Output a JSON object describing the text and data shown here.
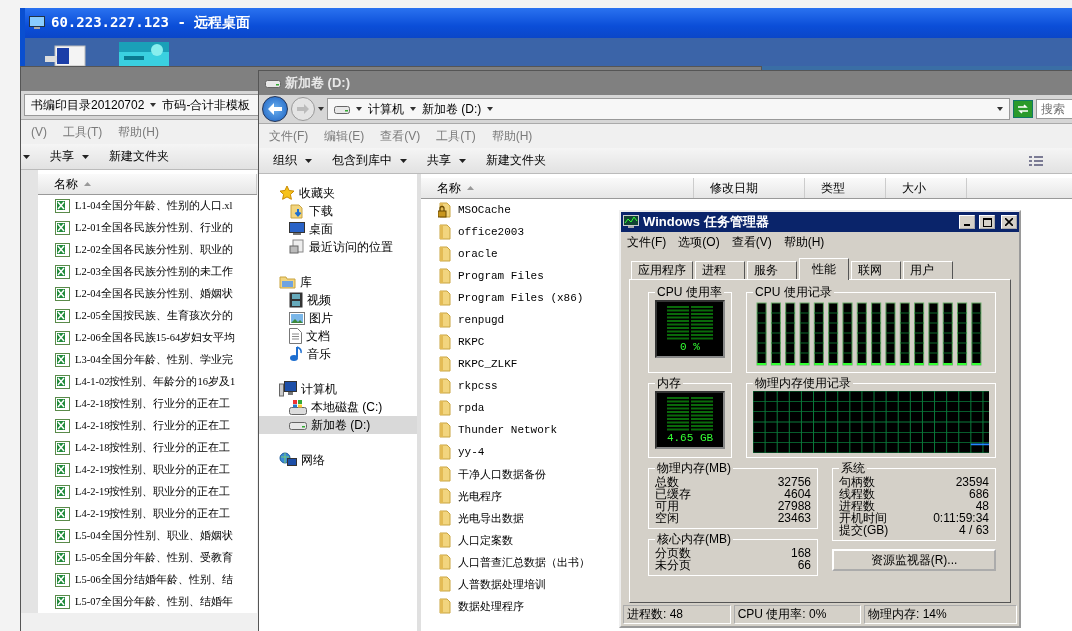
{
  "remote_window": {
    "title": "60.223.227.123 - 远程桌面"
  },
  "explorer_back": {
    "breadcrumb": [
      "书编印目录20120702",
      "市码-合计非模板"
    ],
    "menu": [
      "(V)",
      "工具(T)",
      "帮助(H)"
    ],
    "toolbar": [
      {
        "label": "共享",
        "dropdown": true
      },
      {
        "label": "新建文件夹",
        "dropdown": false
      }
    ],
    "columns": [
      "名称"
    ],
    "files": [
      "L1-04全国分年龄、性别的人口.xl",
      "L2-01全国各民族分性别、行业的",
      "L2-02全国各民族分性别、职业的",
      "L2-03全国各民族分性别的未工作",
      "L2-04全国各民族分性别、婚姻状",
      "L2-05全国按民族、生育孩次分的",
      "L2-06全国各民族15-64岁妇女平均",
      "L3-04全国分年龄、性别、学业完",
      "L4-1-02按性别、年龄分的16岁及1",
      "L4-2-18按性别、行业分的正在工",
      "L4-2-18按性别、行业分的正在工",
      "L4-2-18按性别、行业分的正在工",
      "L4-2-19按性别、职业分的正在工",
      "L4-2-19按性别、职业分的正在工",
      "L4-2-19按性别、职业分的正在工",
      "L5-04全国分性别、职业、婚姻状",
      "L5-05全国分年龄、性别、受教育",
      "L5-06全国分结婚年龄、性别、结",
      "L5-07全国分年龄、性别、结婚年"
    ]
  },
  "explorer_front": {
    "title": "新加卷 (D:)",
    "path": [
      "计算机",
      "新加卷 (D:)"
    ],
    "search_placeholder": "搜索",
    "menu": [
      {
        "label": "文件(F)",
        "disabled": true
      },
      {
        "label": "编辑(E)",
        "disabled": true
      },
      {
        "label": "查看(V)",
        "disabled": true
      },
      {
        "label": "工具(T)",
        "disabled": true
      },
      {
        "label": "帮助(H)",
        "disabled": true
      }
    ],
    "toolbar": [
      {
        "label": "组织",
        "dropdown": true
      },
      {
        "label": "包含到库中",
        "dropdown": true
      },
      {
        "label": "共享",
        "dropdown": true
      },
      {
        "label": "新建文件夹",
        "dropdown": false
      }
    ],
    "nav": [
      {
        "label": "收藏夹",
        "kind": "favorites",
        "selected": false,
        "children": [
          {
            "label": "下载",
            "kind": "downloads",
            "selected": false
          },
          {
            "label": "桌面",
            "kind": "desktop",
            "selected": false
          },
          {
            "label": "最近访问的位置",
            "kind": "recent",
            "selected": false
          }
        ]
      },
      {
        "label": "库",
        "kind": "library",
        "selected": false,
        "children": [
          {
            "label": "视频",
            "kind": "videos",
            "selected": false
          },
          {
            "label": "图片",
            "kind": "pictures",
            "selected": false
          },
          {
            "label": "文档",
            "kind": "documents",
            "selected": false
          },
          {
            "label": "音乐",
            "kind": "music",
            "selected": false
          }
        ]
      },
      {
        "label": "计算机",
        "kind": "computer",
        "selected": false,
        "children": [
          {
            "label": "本地磁盘 (C:)",
            "kind": "local_disk",
            "selected": false
          },
          {
            "label": "新加卷 (D:)",
            "kind": "volume",
            "selected": true
          }
        ]
      },
      {
        "label": "网络",
        "kind": "network",
        "selected": false
      }
    ],
    "columns": [
      "名称",
      "修改日期",
      "类型",
      "大小"
    ],
    "folders": [
      {
        "name": "MSOCache",
        "locked": true
      },
      {
        "name": "office2003",
        "locked": false
      },
      {
        "name": "oracle",
        "locked": false
      },
      {
        "name": "Program Files",
        "locked": false
      },
      {
        "name": "Program Files (x86)",
        "locked": false
      },
      {
        "name": "renpugd",
        "locked": false
      },
      {
        "name": "RKPC",
        "locked": false
      },
      {
        "name": "RKPC_ZLKF",
        "locked": false
      },
      {
        "name": "rkpcss",
        "locked": false
      },
      {
        "name": "rpda",
        "locked": false
      },
      {
        "name": "Thunder Network",
        "locked": false
      },
      {
        "name": "yy-4",
        "locked": false
      },
      {
        "name": "干净人口数据备份",
        "locked": false
      },
      {
        "name": "光电程序",
        "locked": false
      },
      {
        "name": "光电导出数据",
        "locked": false
      },
      {
        "name": "人口定案数",
        "locked": false
      },
      {
        "name": "人口普查汇总数据（出书）",
        "locked": false
      },
      {
        "name": "人普数据处理培训",
        "locked": false
      },
      {
        "name": "数据处理程序",
        "locked": false
      }
    ]
  },
  "task_manager": {
    "title": "Windows 任务管理器",
    "menu": [
      "文件(F)",
      "选项(O)",
      "查看(V)",
      "帮助(H)"
    ],
    "tabs": [
      {
        "label": "应用程序",
        "selected": false
      },
      {
        "label": "进程",
        "selected": false
      },
      {
        "label": "服务",
        "selected": false
      },
      {
        "label": "性能",
        "selected": true
      },
      {
        "label": "联网",
        "selected": false
      },
      {
        "label": "用户",
        "selected": false
      }
    ],
    "cpu": {
      "label": "CPU 使用率",
      "reading": "0 %"
    },
    "cpu_history": {
      "label": "CPU 使用记录"
    },
    "memory": {
      "label": "内存",
      "reading": "4.65 GB"
    },
    "memory_history": {
      "label": "物理内存使用记录"
    },
    "physical_memory": {
      "label": "物理内存(MB)",
      "rows": [
        {
          "label": "总数",
          "value": "32756"
        },
        {
          "label": "已缓存",
          "value": "4604"
        },
        {
          "label": "可用",
          "value": "27988"
        },
        {
          "label": "空闲",
          "value": "23463"
        }
      ]
    },
    "kernel_memory": {
      "label": "核心内存(MB)",
      "rows": [
        {
          "label": "分页数",
          "value": "168"
        },
        {
          "label": "未分页",
          "value": "66"
        }
      ]
    },
    "system": {
      "label": "系统",
      "rows": [
        {
          "label": "句柄数",
          "value": "23594"
        },
        {
          "label": "线程数",
          "value": "686"
        },
        {
          "label": "进程数",
          "value": "48"
        },
        {
          "label": "开机时间",
          "value": "0:11:59:34"
        },
        {
          "label": "提交(GB)",
          "value": "4 / 63"
        }
      ]
    },
    "button": "资源监视器(R)...",
    "status": [
      "进程数: 48",
      "CPU 使用率: 0%",
      "物理内存: 14%"
    ]
  }
}
